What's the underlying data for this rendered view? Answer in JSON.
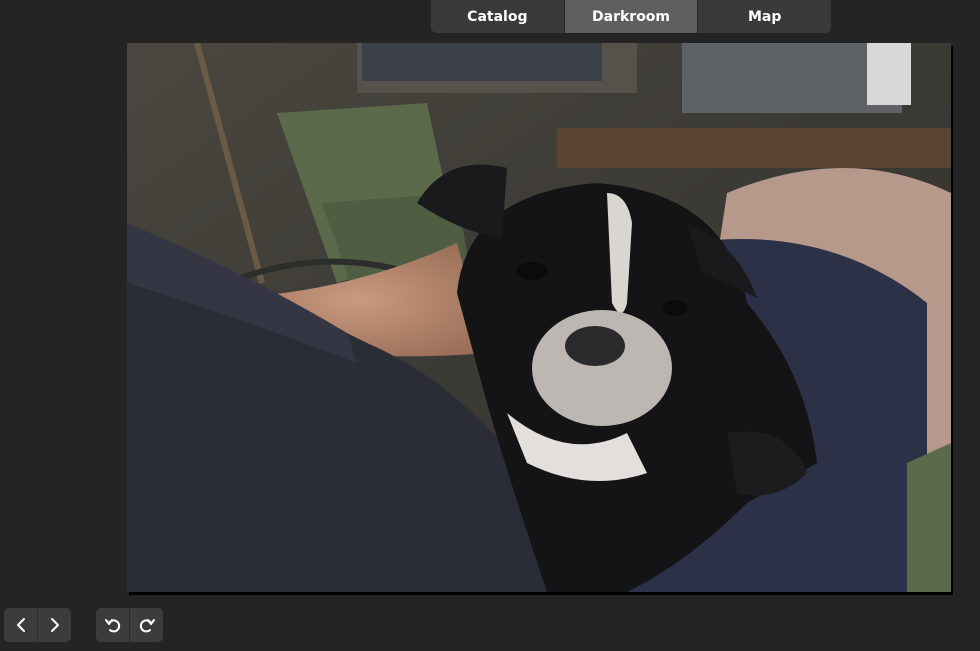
{
  "mode_switcher": {
    "tabs": [
      {
        "label": "Catalog",
        "active": false
      },
      {
        "label": "Darkroom",
        "active": true
      },
      {
        "label": "Map",
        "active": false
      }
    ]
  },
  "photo": {
    "subject": "black and white puppy"
  },
  "navigation": {
    "previous_icon": "chevron-left-icon",
    "next_icon": "chevron-right-icon"
  },
  "history": {
    "undo_icon": "undo-icon",
    "redo_icon": "redo-icon"
  },
  "colors": {
    "background": "#242424",
    "tab_bar": "#3a3a3a",
    "tab_active": "#5f5f5f",
    "button": "#3c3c3c",
    "text": "#ffffff"
  }
}
